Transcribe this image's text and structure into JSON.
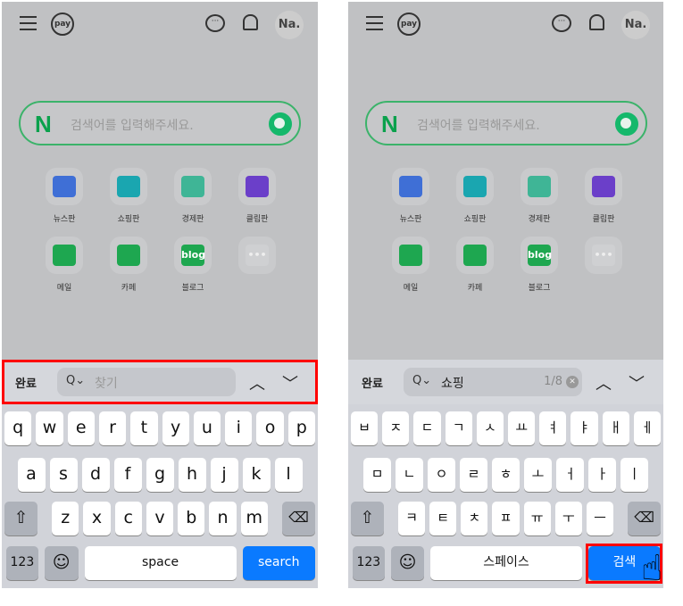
{
  "header": {
    "pay": "pay",
    "chat": "···",
    "avatar": "Na."
  },
  "search": {
    "logo": "N",
    "placeholder": "검색어를 입력해주세요."
  },
  "apps": [
    {
      "label": "뉴스판",
      "color": "#3f6fd6",
      "icon": "news-icon"
    },
    {
      "label": "쇼핑판",
      "color": "#1aa6b0",
      "icon": "shopping-icon"
    },
    {
      "label": "경제판",
      "color": "#3fb596",
      "icon": "economy-icon"
    },
    {
      "label": "클립판",
      "color": "#6b3fc9",
      "icon": "clip-icon"
    },
    {
      "label": "메일",
      "color": "#1ea750",
      "icon": "mail-icon"
    },
    {
      "label": "카페",
      "color": "#1ea750",
      "icon": "cafe-icon"
    },
    {
      "label": "블로그",
      "color": "#1ea750",
      "icon": "blog-icon",
      "text": "blog"
    },
    {
      "label": "",
      "color": "#cfd0d2",
      "icon": "more-icon",
      "text": "•••"
    }
  ],
  "left": {
    "find": {
      "done": "완료",
      "placeholder": "찾기",
      "search_icon": "Q⌄"
    },
    "rows": [
      [
        "q",
        "w",
        "e",
        "r",
        "t",
        "y",
        "u",
        "i",
        "o",
        "p"
      ],
      [
        "a",
        "s",
        "d",
        "f",
        "g",
        "h",
        "j",
        "k",
        "l"
      ],
      [
        "z",
        "x",
        "c",
        "v",
        "b",
        "n",
        "m"
      ]
    ],
    "num": "123",
    "space": "space",
    "action": "search"
  },
  "right": {
    "find": {
      "done": "완료",
      "value": "쇼핑",
      "count": "1/8",
      "search_icon": "Q⌄"
    },
    "rows": [
      [
        "ㅂ",
        "ㅈ",
        "ㄷ",
        "ㄱ",
        "ㅅ",
        "ㅛ",
        "ㅕ",
        "ㅑ",
        "ㅐ",
        "ㅔ"
      ],
      [
        "ㅁ",
        "ㄴ",
        "ㅇ",
        "ㄹ",
        "ㅎ",
        "ㅗ",
        "ㅓ",
        "ㅏ",
        "ㅣ"
      ],
      [
        "ㅋ",
        "ㅌ",
        "ㅊ",
        "ㅍ",
        "ㅠ",
        "ㅜ",
        "ㅡ"
      ]
    ],
    "num": "123",
    "space": "스페이스",
    "action": "검색"
  },
  "colors": {
    "accent": "#0a7aff",
    "highlight": "#ff0000",
    "naver_green": "#0aa14c"
  }
}
